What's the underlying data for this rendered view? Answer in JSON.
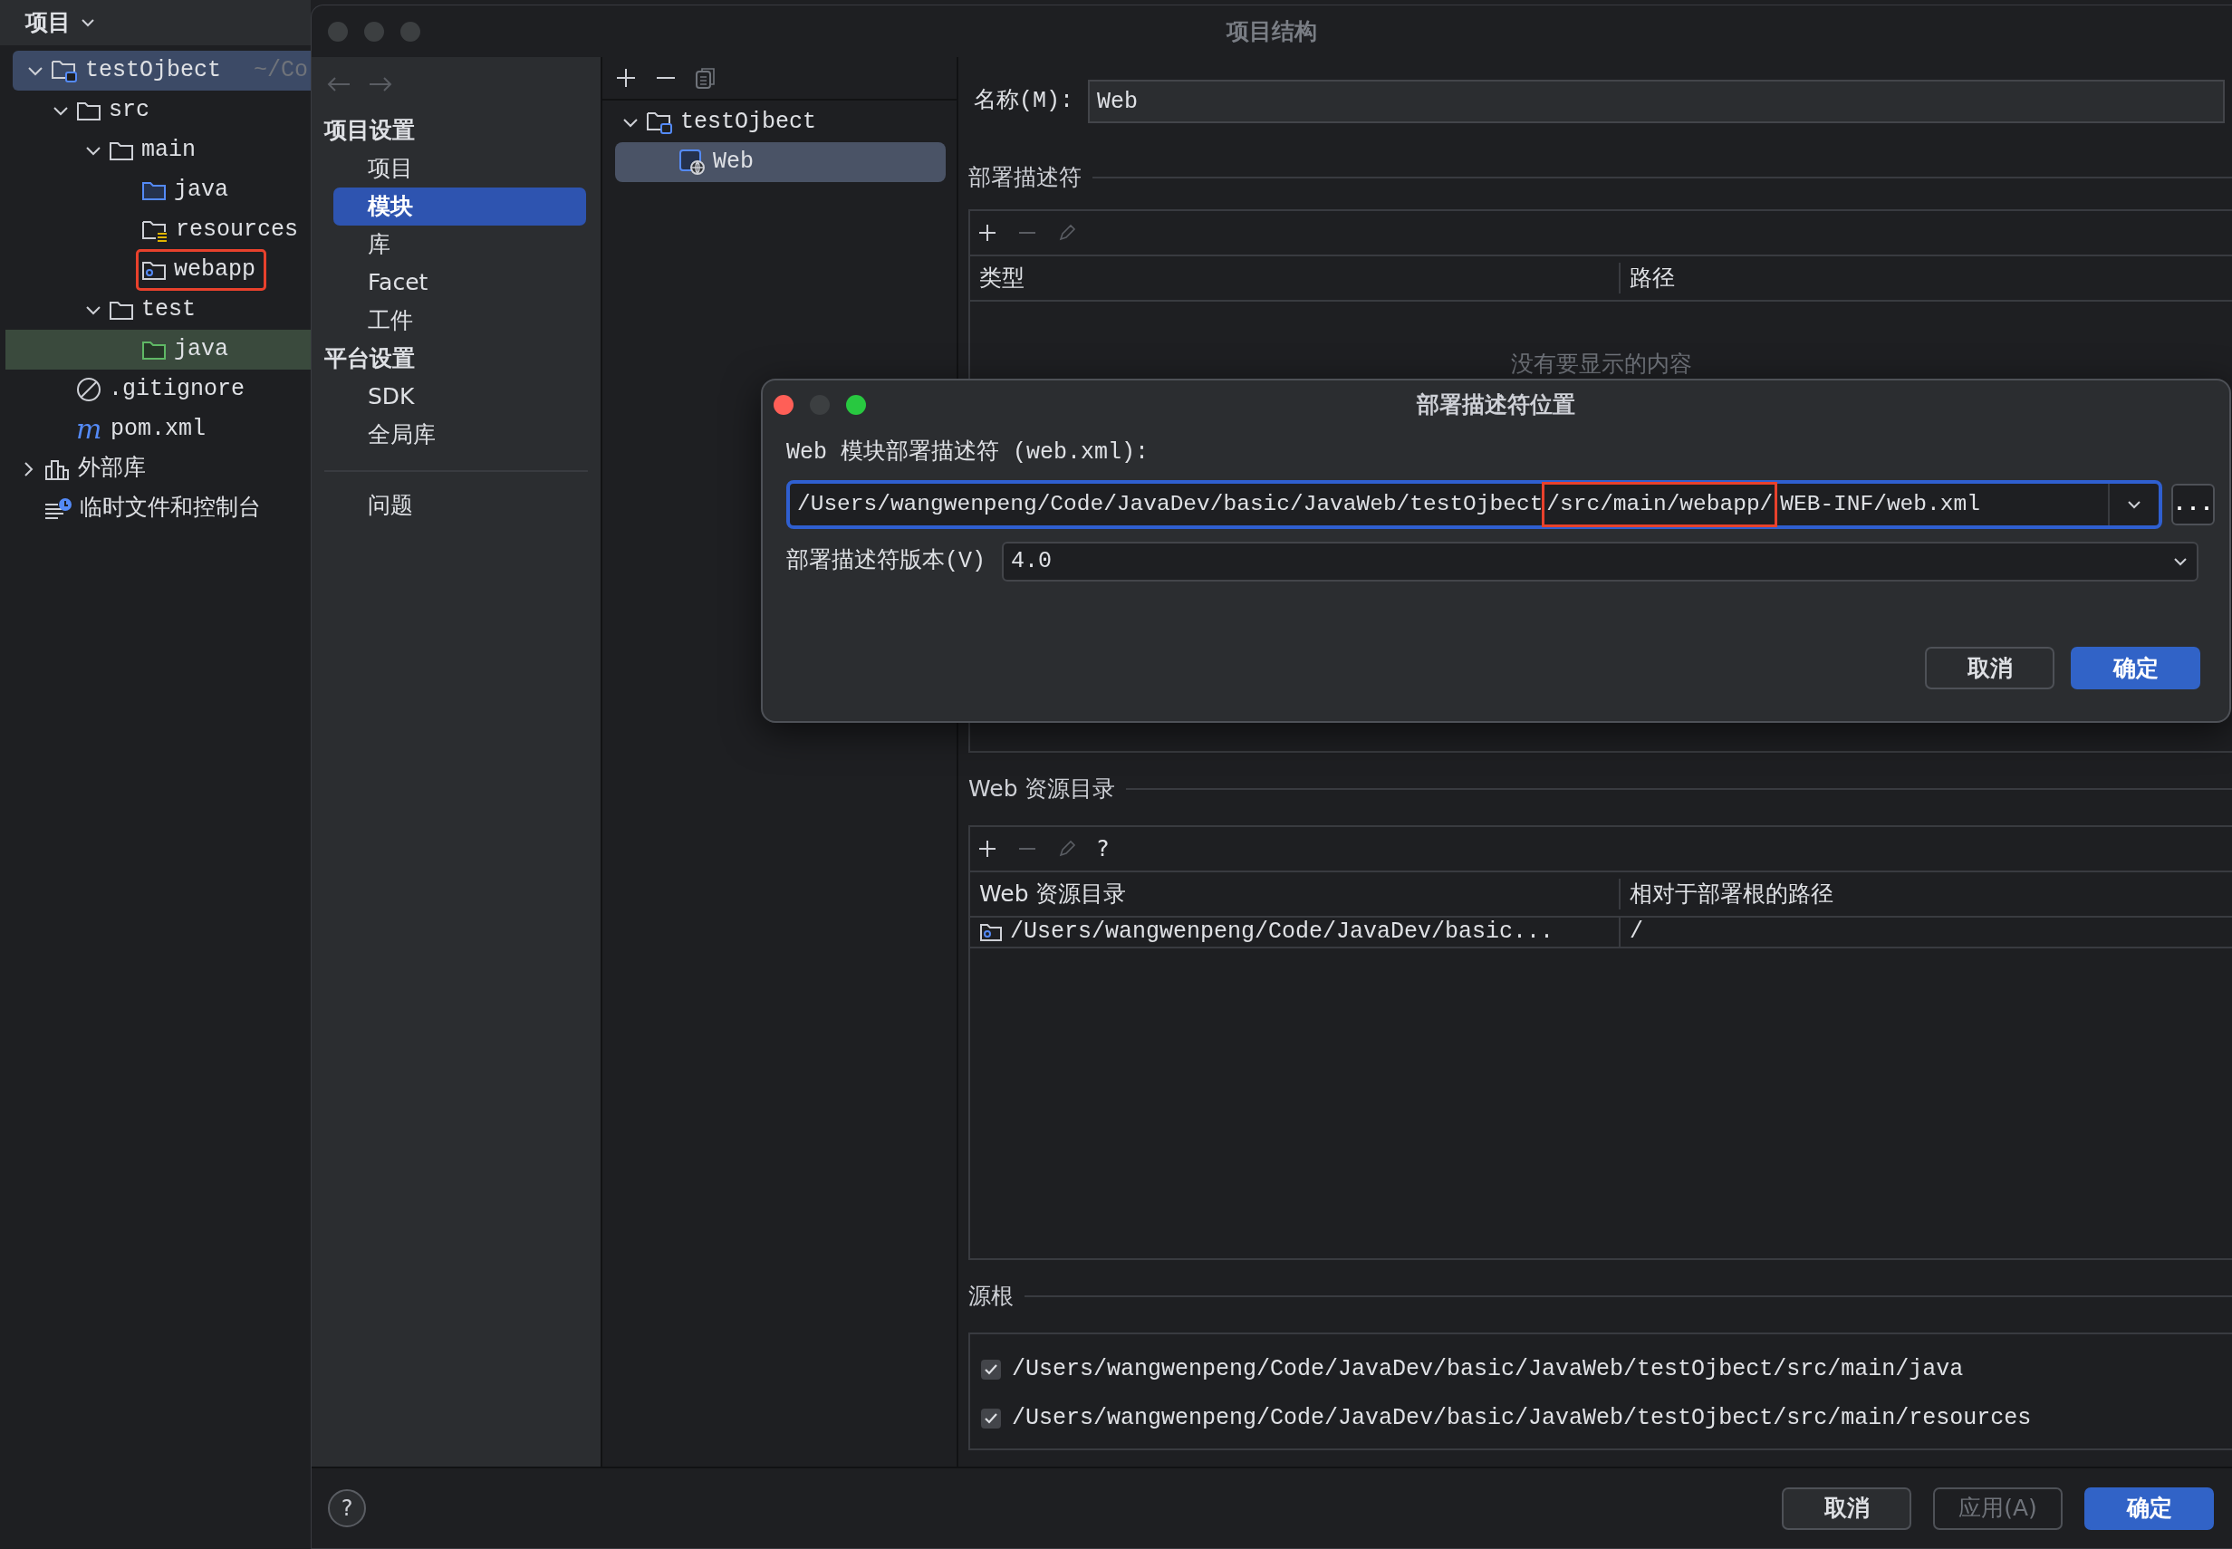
{
  "project_panel": {
    "title": "项目",
    "tree": [
      {
        "label": "testOjbect",
        "hint": "~/Co",
        "kind": "module",
        "expanded": true,
        "selected": true,
        "annotated": false,
        "children": [
          {
            "label": "src",
            "kind": "folder",
            "expanded": true,
            "selected": false,
            "annotated": false,
            "children": [
              {
                "label": "main",
                "kind": "folder",
                "expanded": true,
                "selected": false,
                "annotated": false,
                "children": [
                  {
                    "label": "java",
                    "kind": "source",
                    "selected": false,
                    "annotated": false
                  },
                  {
                    "label": "resources",
                    "kind": "resources",
                    "selected": false,
                    "annotated": false
                  },
                  {
                    "label": "webapp",
                    "kind": "web",
                    "selected": false,
                    "annotated": true
                  }
                ]
              },
              {
                "label": "test",
                "kind": "folder",
                "expanded": true,
                "selected": false,
                "annotated": false,
                "children": [
                  {
                    "label": "java",
                    "kind": "test",
                    "selected": false,
                    "annotated": false
                  }
                ]
              }
            ]
          },
          {
            "label": ".gitignore",
            "kind": "ignore",
            "selected": false,
            "annotated": false
          },
          {
            "label": "pom.xml",
            "kind": "maven",
            "icon_text": "m",
            "selected": false,
            "annotated": false
          }
        ]
      },
      {
        "label": "外部库",
        "kind": "library",
        "expanded": false,
        "selected": false,
        "annotated": false
      },
      {
        "label": "临时文件和控制台",
        "kind": "scratch",
        "selected": false,
        "annotated": false
      }
    ]
  },
  "dialog": {
    "title": "项目结构",
    "active": false,
    "nav": {
      "sections": [
        {
          "heading": "项目设置",
          "items": [
            {
              "label": "项目",
              "selected": false
            },
            {
              "label": "模块",
              "selected": true
            },
            {
              "label": "库",
              "selected": false
            },
            {
              "label": "Facet",
              "selected": false
            },
            {
              "label": "工件",
              "selected": false
            }
          ]
        },
        {
          "heading": "平台设置",
          "items": [
            {
              "label": "SDK",
              "selected": false
            },
            {
              "label": "全局库",
              "selected": false
            }
          ]
        }
      ],
      "footer_items": [
        {
          "label": "问题",
          "selected": false
        }
      ]
    },
    "module_tree": [
      {
        "label": "testOjbect",
        "kind": "module",
        "expanded": true,
        "selected": false,
        "children": [
          {
            "label": "Web",
            "kind": "web-module",
            "selected": true
          }
        ]
      }
    ],
    "name_field": {
      "label": "名称(M):",
      "value": "Web"
    },
    "descriptors": {
      "title": "部署描述符",
      "columns": [
        "类型",
        "路径"
      ],
      "empty_text": "没有要显示的内容"
    },
    "resource_dirs": {
      "title": "Web 资源目录",
      "toolbar_help": "?",
      "columns": [
        "Web 资源目录",
        "相对于部署根的路径"
      ],
      "rows": [
        [
          "/Users/wangwenpeng/Code/JavaDev/basic...",
          "/"
        ]
      ]
    },
    "source_roots": {
      "title": "源根",
      "items": [
        {
          "path": "/Users/wangwenpeng/Code/JavaDev/basic/JavaWeb/testOjbect/src/main/java",
          "checked": true
        },
        {
          "path": "/Users/wangwenpeng/Code/JavaDev/basic/JavaWeb/testOjbect/src/main/resources",
          "checked": true
        }
      ]
    },
    "help": "?",
    "buttons": [
      {
        "label": "取消",
        "kind": "secondary",
        "disabled": false
      },
      {
        "label": "应用(A)",
        "kind": "secondary",
        "disabled": true
      },
      {
        "label": "确定",
        "kind": "primary",
        "disabled": false
      }
    ]
  },
  "modal": {
    "title": "部署描述符位置",
    "active": true,
    "descriptor_label": "Web 模块部署描述符 (web.xml):",
    "path_parts": [
      {
        "text": "/Users/wangwenpeng/Code/JavaDev/basic/JavaWeb/testOjbect",
        "annotated": false
      },
      {
        "text": "/src/main/webapp/",
        "annotated": true
      },
      {
        "text": "WEB-INF/web.xml",
        "annotated": false
      }
    ],
    "browse_button": "...",
    "version_label": "部署描述符版本(V)",
    "version_value": "4.0",
    "buttons": [
      {
        "label": "取消",
        "kind": "secondary",
        "disabled": false
      },
      {
        "label": "确定",
        "kind": "primary",
        "disabled": false
      }
    ]
  }
}
